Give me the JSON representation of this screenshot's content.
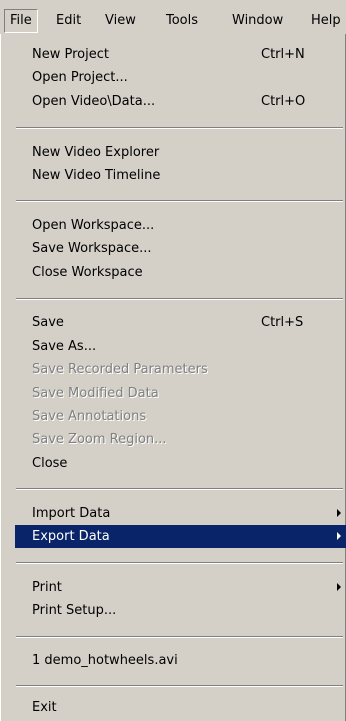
{
  "menubar": {
    "items": [
      {
        "label": "File",
        "mnemonic": "F"
      },
      {
        "label": "Edit",
        "mnemonic": "E"
      },
      {
        "label": "View",
        "mnemonic": "V"
      },
      {
        "label": "Tools",
        "mnemonic": "T"
      },
      {
        "label": "Window",
        "mnemonic": "W"
      },
      {
        "label": "Help",
        "mnemonic": "H"
      }
    ]
  },
  "file_menu": {
    "new_project": {
      "label": "New Project",
      "shortcut": "Ctrl+N"
    },
    "open_project": {
      "label": "Open Project..."
    },
    "open_video_data": {
      "label": "Open Video\\Data...",
      "shortcut": "Ctrl+O"
    },
    "new_video_explorer": {
      "label": "New Video Explorer"
    },
    "new_video_timeline": {
      "label": "New Video Timeline"
    },
    "open_workspace": {
      "label": "Open Workspace..."
    },
    "save_workspace": {
      "label": "Save Workspace..."
    },
    "close_workspace": {
      "label": "Close Workspace"
    },
    "save": {
      "label": "Save",
      "shortcut": "Ctrl+S"
    },
    "save_as": {
      "label": "Save As..."
    },
    "save_recorded_parameters": {
      "label": "Save Recorded Parameters",
      "enabled": false
    },
    "save_modified_data": {
      "label": "Save Modified Data",
      "enabled": false
    },
    "save_annotations": {
      "label": "Save Annotations",
      "enabled": false
    },
    "save_zoom_region": {
      "label": "Save Zoom Region...",
      "enabled": false
    },
    "close": {
      "label": "Close"
    },
    "import_data": {
      "label": "Import Data",
      "submenu": true
    },
    "export_data": {
      "label": "Export Data",
      "submenu": true,
      "highlighted": true
    },
    "print": {
      "label": "Print",
      "submenu": true
    },
    "print_setup": {
      "label": "Print Setup..."
    },
    "recent_file_1": {
      "label": "1 demo_hotwheels.avi"
    },
    "exit": {
      "label": "Exit"
    }
  },
  "colors": {
    "menu_face": "#d4d0c8",
    "highlight": "#0a246a",
    "highlight_text": "#ffffff",
    "disabled_text": "#808080"
  },
  "icons": {
    "submenu_arrow": "right-triangle-arrow"
  }
}
